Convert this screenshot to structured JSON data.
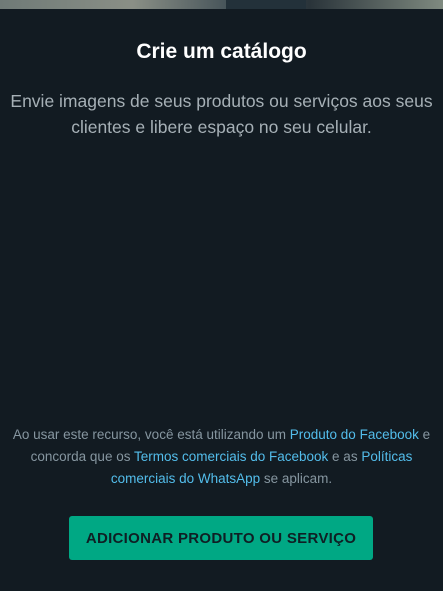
{
  "catalog": {
    "title": "Crie um catálogo",
    "subtitle": "Envie imagens de seus produtos ou serviços aos seus clientes e libere espaço no seu celular."
  },
  "legal": {
    "part1": "Ao usar este recurso, você está utilizando um ",
    "link1": "Produto do Facebook",
    "part2": " e concorda que os ",
    "link2": "Termos comerciais do Facebook",
    "part3": " e as ",
    "link3": "Políticas comerciais do WhatsApp",
    "part4": " se aplicam."
  },
  "cta": {
    "label": "ADICIONAR PRODUTO OU SERVIÇO"
  },
  "colors": {
    "background": "#121b22",
    "accent": "#00a884",
    "link": "#53bdeb"
  }
}
